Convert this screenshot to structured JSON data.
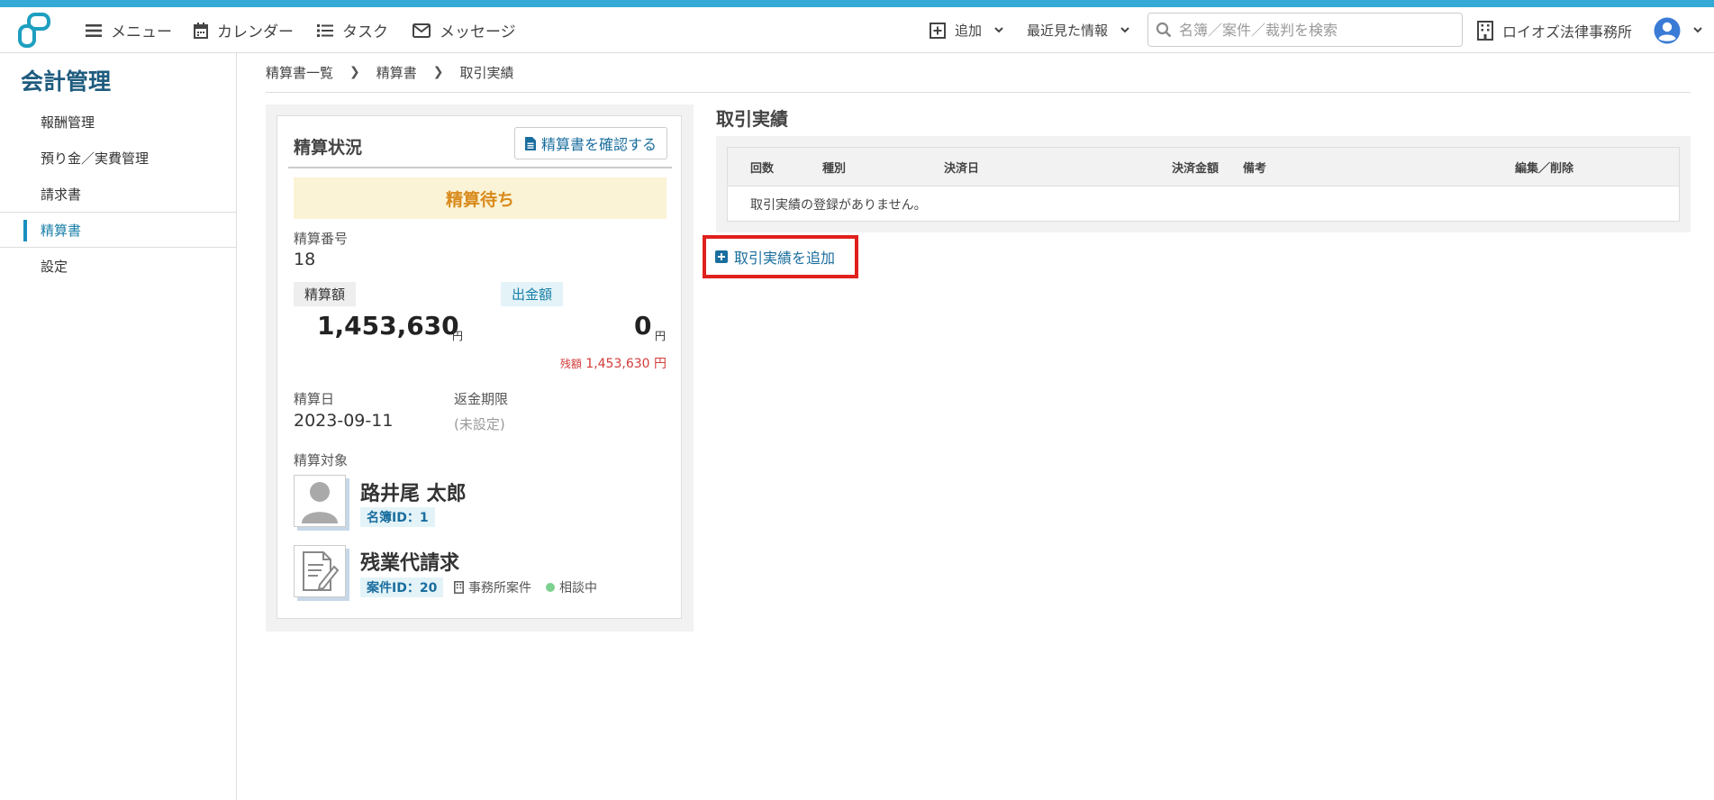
{
  "header": {
    "nav": [
      {
        "label": "メニュー",
        "icon": "hamburger-icon"
      },
      {
        "label": "カレンダー",
        "icon": "calendar-icon"
      },
      {
        "label": "タスク",
        "icon": "list-icon"
      },
      {
        "label": "メッセージ",
        "icon": "envelope-icon"
      }
    ],
    "add_label": "追加",
    "recent_label": "最近見た情報",
    "search_placeholder": "名簿／案件／裁判を検索",
    "office_name": "ロイオズ法律事務所",
    "accent_color": "#35a9d6"
  },
  "sidebar": {
    "title": "会計管理",
    "items": [
      {
        "label": "報酬管理",
        "active": false
      },
      {
        "label": "預り金／実費管理",
        "active": false
      },
      {
        "label": "請求書",
        "active": false
      },
      {
        "label": "精算書",
        "active": true
      },
      {
        "label": "設定",
        "active": false
      }
    ]
  },
  "breadcrumb": [
    "精算書一覧",
    "精算書",
    "取引実績"
  ],
  "settlement": {
    "title": "精算状況",
    "confirm_button": "精算書を確認する",
    "status": "精算待ち",
    "number_label": "精算番号",
    "number": "18",
    "amount_label": "精算額",
    "amount": "1,453,630",
    "payout_label": "出金額",
    "payout": "0",
    "currency": "円",
    "remaining_label": "残額",
    "remaining": "1,453,630 円",
    "date_label": "精算日",
    "date": "2023-09-11",
    "deadline_label": "返金期限",
    "deadline": "(未設定)",
    "target_label": "精算対象",
    "person": {
      "name": "路井尾 太郎",
      "id_badge": "名簿ID：1"
    },
    "case": {
      "name": "残業代請求",
      "id_badge": "案件ID：20",
      "type": "事務所案件",
      "status": "相談中"
    }
  },
  "transactions": {
    "title": "取引実績",
    "columns": [
      "回数",
      "種別",
      "決済日",
      "決済金額",
      "備考",
      "編集／削除"
    ],
    "empty_message": "取引実績の登録がありません。",
    "add_label": "取引実績を追加"
  }
}
